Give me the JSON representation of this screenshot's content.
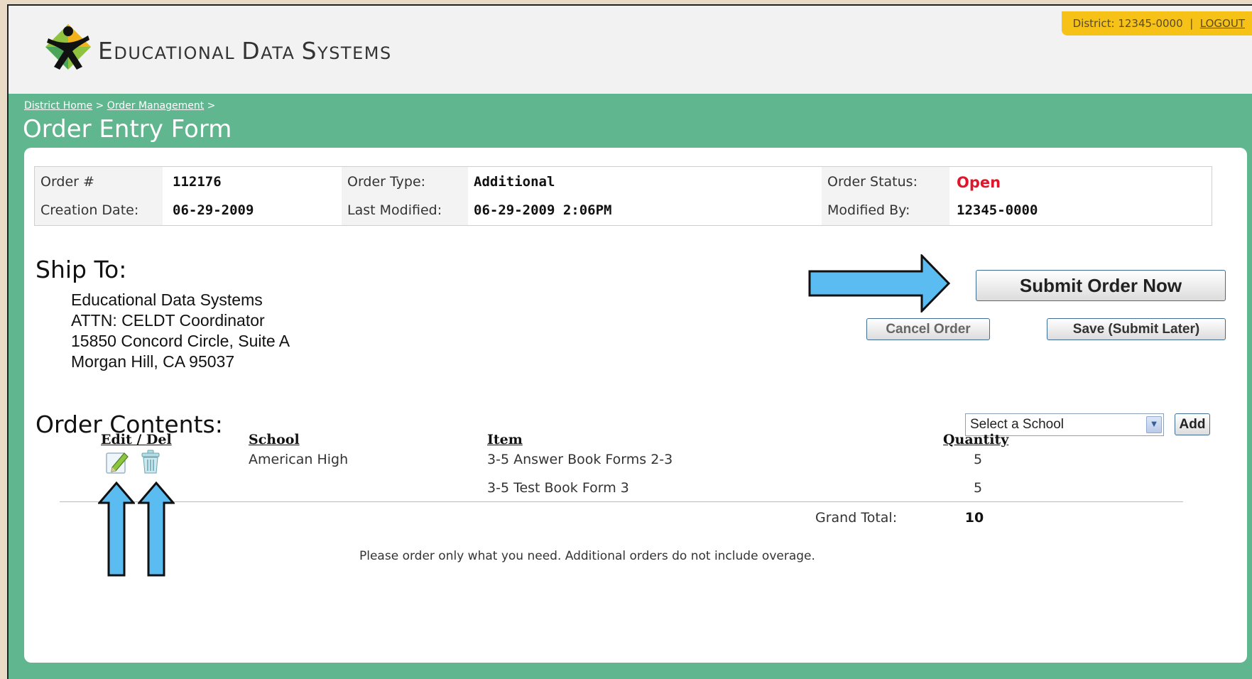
{
  "header": {
    "brand_lead_e": "E",
    "brand_rest_e": "DUCATIONAL",
    "brand_lead_d": "D",
    "brand_rest_d": "ATA",
    "brand_lead_s": "S",
    "brand_rest_s": "YSTEMS",
    "district_text": "District: 12345-0000",
    "separator": "|",
    "logout_label": "LOGOUT"
  },
  "breadcrumb": {
    "home": "District Home",
    "sep1": ">",
    "order_mgmt": "Order Management",
    "sep2": ">"
  },
  "page_title": "Order Entry Form",
  "order_info": {
    "order_num_label": "Order #",
    "order_num": "112176",
    "creation_label": "Creation Date:",
    "creation_date": "06-29-2009",
    "type_label": "Order Type:",
    "type": "Additional",
    "modified_label": "Last Modified:",
    "modified": "06-29-2009 2:06PM",
    "status_label": "Order Status:",
    "status": "Open",
    "modified_by_label": "Modified By:",
    "modified_by": "12345-0000"
  },
  "ship_to": {
    "heading": "Ship To:",
    "lines": [
      "Educational Data Systems",
      "ATTN: CELDT Coordinator",
      "15850 Concord Circle, Suite A",
      "Morgan Hill, CA 95037"
    ]
  },
  "actions": {
    "submit": "Submit Order Now",
    "cancel": "Cancel Order",
    "save": "Save (Submit Later)"
  },
  "contents": {
    "heading": "Order Contents:",
    "select_placeholder": "Select a School",
    "add_label": "Add",
    "columns": [
      "Edit / Del",
      "School",
      "Item",
      "Quantity"
    ],
    "rows": [
      {
        "school": "American High",
        "item": "3-5 Answer Book Forms 2-3",
        "quantity": "5"
      },
      {
        "school": "",
        "item": "3-5 Test Book Form 3",
        "quantity": "5"
      }
    ],
    "grand_total_label": "Grand Total:",
    "grand_total": "10",
    "note": "Please order only what you need. Additional orders do not include overage."
  },
  "colors": {
    "green_band": "#60b68e",
    "user_box": "#f7c218",
    "status_open": "#e0162b",
    "arrow_fill": "#5bbcf2"
  },
  "icons": [
    "logo-icon",
    "edit-icon",
    "delete-icon",
    "arrow-right-icon",
    "arrow-up-icon"
  ]
}
